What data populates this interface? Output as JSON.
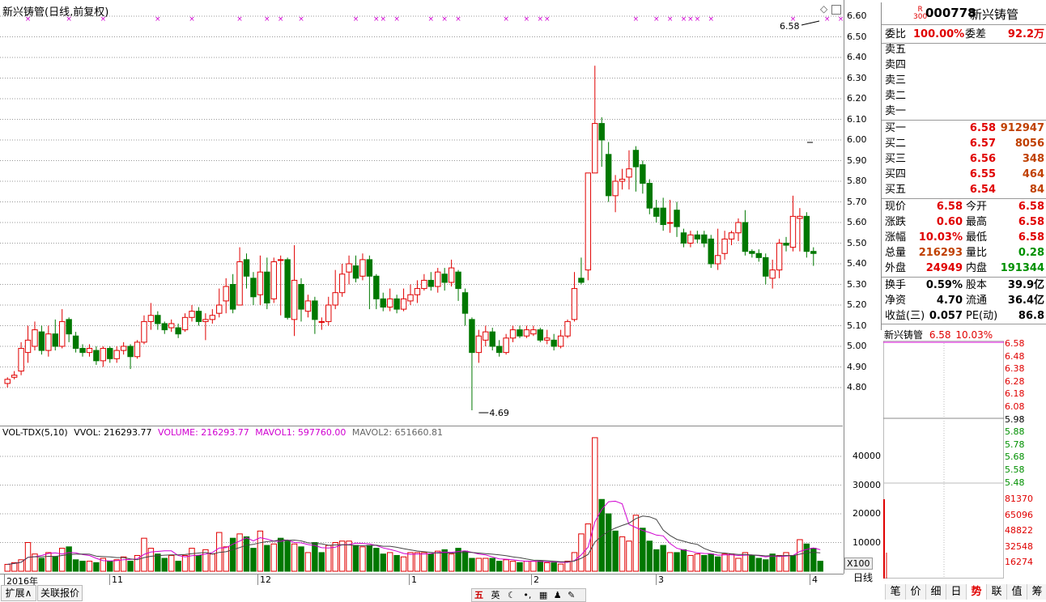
{
  "chart": {
    "title": "新兴铸管(日线,前复权)",
    "price_labels": [
      "6.60",
      "6.50",
      "6.40",
      "6.30",
      "6.20",
      "6.10",
      "6.00",
      "5.90",
      "5.80",
      "5.70",
      "5.60",
      "5.50",
      "5.40",
      "5.30",
      "5.20",
      "5.10",
      "5.00",
      "4.90",
      "4.80"
    ],
    "high_label": "6.58",
    "low_label": "4.69",
    "date_labels": [
      "2016年",
      "11",
      "12",
      "1",
      "2",
      "3",
      "4"
    ],
    "volume_header": {
      "name": "VOL-TDX(5,10)",
      "vvol": "VVOL: 216293.77",
      "volume": "VOLUME: 216293.77",
      "mavol1": "MAVOL1: 597760.00",
      "mavol2": "MAVOL2: 651660.81"
    },
    "volume_labels": [
      "40000",
      "30000",
      "20000",
      "10000"
    ],
    "volume_unit": "X100",
    "period_button": "日线",
    "expand_button": "扩展∧",
    "related_button": "关联报价"
  },
  "quote": {
    "code": "000778",
    "name": "新兴铸管",
    "badge_r": "R",
    "badge_num": "300",
    "wei_bi_label": "委比",
    "wei_bi": "100.00%",
    "wei_cha_label": "委差",
    "wei_cha": "92.2万",
    "sell": [
      {
        "label": "卖五",
        "price": "",
        "vol": ""
      },
      {
        "label": "卖四",
        "price": "",
        "vol": ""
      },
      {
        "label": "卖三",
        "price": "",
        "vol": ""
      },
      {
        "label": "卖二",
        "price": "",
        "vol": ""
      },
      {
        "label": "卖一",
        "price": "",
        "vol": ""
      }
    ],
    "buy": [
      {
        "label": "买一",
        "price": "6.58",
        "vol": "912947"
      },
      {
        "label": "买二",
        "price": "6.57",
        "vol": "8056"
      },
      {
        "label": "买三",
        "price": "6.56",
        "vol": "348"
      },
      {
        "label": "买四",
        "price": "6.55",
        "vol": "464"
      },
      {
        "label": "买五",
        "price": "6.54",
        "vol": "84"
      }
    ],
    "stats": [
      {
        "l1": "现价",
        "v1": "6.58",
        "c1": "red",
        "l2": "今开",
        "v2": "6.58",
        "c2": "red"
      },
      {
        "l1": "涨跌",
        "v1": "0.60",
        "c1": "red",
        "l2": "最高",
        "v2": "6.58",
        "c2": "red"
      },
      {
        "l1": "涨幅",
        "v1": "10.03%",
        "c1": "red",
        "l2": "最低",
        "v2": "6.58",
        "c2": "red"
      },
      {
        "l1": "总量",
        "v1": "216293",
        "c1": "orange",
        "l2": "量比",
        "v2": "0.28",
        "c2": "green"
      },
      {
        "l1": "外盘",
        "v1": "24949",
        "c1": "red",
        "l2": "内盘",
        "v2": "191344",
        "c2": "green"
      }
    ],
    "stats2": [
      {
        "l1": "换手",
        "v1": "0.59%",
        "l2": "股本",
        "v2": "39.9亿"
      },
      {
        "l1": "净资",
        "v1": "4.70",
        "l2": "流通",
        "v2": "36.4亿"
      },
      {
        "l1": "收益(三)",
        "v1": "0.057",
        "l2": "PE(动)",
        "v2": "86.8"
      }
    ]
  },
  "intraday": {
    "name": "新兴铸管",
    "price": "6.58",
    "change": "10.03%",
    "price_labels": [
      "6.58",
      "6.48",
      "6.38",
      "6.28",
      "6.18",
      "6.08",
      "5.98",
      "5.88",
      "5.78",
      "5.68",
      "5.58",
      "5.48"
    ],
    "vol_labels": [
      "81370",
      "65096",
      "48822",
      "32548",
      "16274"
    ]
  },
  "tabs": [
    "笔",
    "价",
    "细",
    "日",
    "势",
    "联",
    "值",
    "筹"
  ],
  "active_tab": "势",
  "status_icons": [
    "五",
    "英"
  ],
  "candles": [
    [
      4.82,
      4.84,
      4.8,
      4.85
    ],
    [
      4.85,
      4.86,
      4.84,
      4.88
    ],
    [
      4.88,
      4.99,
      4.86,
      5.02
    ],
    [
      4.97,
      5.03,
      4.92,
      5.1
    ],
    [
      5.0,
      5.08,
      4.98,
      5.12
    ],
    [
      5.07,
      4.98,
      4.96,
      5.1
    ],
    [
      4.98,
      5.06,
      4.95,
      5.1
    ],
    [
      5.06,
      5.0,
      4.98,
      5.13
    ],
    [
      5.0,
      5.12,
      4.99,
      5.18
    ],
    [
      5.13,
      5.06,
      5.02,
      5.14
    ],
    [
      5.05,
      4.99,
      4.97,
      5.07
    ],
    [
      4.99,
      4.97,
      4.95,
      5.01
    ],
    [
      4.97,
      4.99,
      4.95,
      5.01
    ],
    [
      4.98,
      4.93,
      4.91,
      5.0
    ],
    [
      4.93,
      4.99,
      4.9,
      5.0
    ],
    [
      4.99,
      4.94,
      4.92,
      5.0
    ],
    [
      4.94,
      4.98,
      4.92,
      5.0
    ],
    [
      4.98,
      5.0,
      4.96,
      5.02
    ],
    [
      5.0,
      4.95,
      4.89,
      5.01
    ],
    [
      4.95,
      5.02,
      4.94,
      5.03
    ],
    [
      5.02,
      5.12,
      5.01,
      5.15
    ],
    [
      5.12,
      5.15,
      5.08,
      5.21
    ],
    [
      5.15,
      5.11,
      5.08,
      5.17
    ],
    [
      5.11,
      5.08,
      5.06,
      5.12
    ],
    [
      5.09,
      5.11,
      5.07,
      5.13
    ],
    [
      5.09,
      5.06,
      5.04,
      5.11
    ],
    [
      5.08,
      5.14,
      5.07,
      5.16
    ],
    [
      5.14,
      5.17,
      5.12,
      5.2
    ],
    [
      5.17,
      5.12,
      5.1,
      5.19
    ],
    [
      5.12,
      5.13,
      5.03,
      5.16
    ],
    [
      5.13,
      5.15,
      5.11,
      5.18
    ],
    [
      5.16,
      5.2,
      5.14,
      5.28
    ],
    [
      5.22,
      5.29,
      5.16,
      5.33
    ],
    [
      5.3,
      5.18,
      5.16,
      5.35
    ],
    [
      5.2,
      5.41,
      5.2,
      5.48
    ],
    [
      5.42,
      5.34,
      5.28,
      5.45
    ],
    [
      5.33,
      5.24,
      5.2,
      5.36
    ],
    [
      5.25,
      5.36,
      5.2,
      5.44
    ],
    [
      5.36,
      5.21,
      5.18,
      5.43
    ],
    [
      5.23,
      5.41,
      5.21,
      5.43
    ],
    [
      5.42,
      5.42,
      5.15,
      5.44
    ],
    [
      5.42,
      5.14,
      5.13,
      5.43
    ],
    [
      5.13,
      5.32,
      5.05,
      5.49
    ],
    [
      5.3,
      5.18,
      5.12,
      5.33
    ],
    [
      5.17,
      5.22,
      5.14,
      5.25
    ],
    [
      5.22,
      5.13,
      5.06,
      5.24
    ],
    [
      5.12,
      5.12,
      5.08,
      5.14
    ],
    [
      5.12,
      5.2,
      5.1,
      5.24
    ],
    [
      5.2,
      5.26,
      5.18,
      5.37
    ],
    [
      5.26,
      5.35,
      5.24,
      5.4
    ],
    [
      5.36,
      5.4,
      5.3,
      5.44
    ],
    [
      5.39,
      5.33,
      5.31,
      5.44
    ],
    [
      5.34,
      5.42,
      5.32,
      5.45
    ],
    [
      5.42,
      5.34,
      5.18,
      5.44
    ],
    [
      5.34,
      5.23,
      5.18,
      5.35
    ],
    [
      5.23,
      5.19,
      5.17,
      5.26
    ],
    [
      5.19,
      5.23,
      5.17,
      5.28
    ],
    [
      5.23,
      5.18,
      5.16,
      5.25
    ],
    [
      5.18,
      5.23,
      5.17,
      5.28
    ],
    [
      5.22,
      5.25,
      5.2,
      5.3
    ],
    [
      5.25,
      5.28,
      5.21,
      5.32
    ],
    [
      5.28,
      5.32,
      5.27,
      5.35
    ],
    [
      5.32,
      5.29,
      5.27,
      5.36
    ],
    [
      5.29,
      5.36,
      5.26,
      5.38
    ],
    [
      5.35,
      5.31,
      5.27,
      5.38
    ],
    [
      5.31,
      5.38,
      5.29,
      5.42
    ],
    [
      5.36,
      5.28,
      5.22,
      5.37
    ],
    [
      5.26,
      5.16,
      5.1,
      5.28
    ],
    [
      5.13,
      4.97,
      4.69,
      5.14
    ],
    [
      4.97,
      5.05,
      4.92,
      5.08
    ],
    [
      5.03,
      5.07,
      5.0,
      5.1
    ],
    [
      5.07,
      5.0,
      4.98,
      5.09
    ],
    [
      5.0,
      4.97,
      4.95,
      5.03
    ],
    [
      4.97,
      5.04,
      4.96,
      5.06
    ],
    [
      5.04,
      5.08,
      5.02,
      5.1
    ],
    [
      5.08,
      5.05,
      5.04,
      5.1
    ],
    [
      5.05,
      5.08,
      5.04,
      5.1
    ],
    [
      5.06,
      5.08,
      5.05,
      5.1
    ],
    [
      5.08,
      5.03,
      5.02,
      5.09
    ],
    [
      5.03,
      5.04,
      5.01,
      5.08
    ],
    [
      5.03,
      5.0,
      4.98,
      5.06
    ],
    [
      5.0,
      5.05,
      4.99,
      5.08
    ],
    [
      5.05,
      5.12,
      5.04,
      5.13
    ],
    [
      5.13,
      5.28,
      5.12,
      5.36
    ],
    [
      5.33,
      5.31,
      5.3,
      5.43
    ],
    [
      5.37,
      5.84,
      5.32,
      5.84
    ],
    [
      5.84,
      6.08,
      5.92,
      6.36
    ],
    [
      6.08,
      6.0,
      5.87,
      6.11
    ],
    [
      5.93,
      5.73,
      5.7,
      5.99
    ],
    [
      5.73,
      5.8,
      5.65,
      5.83
    ],
    [
      5.8,
      5.81,
      5.76,
      5.86
    ],
    [
      5.82,
      5.86,
      5.76,
      5.95
    ],
    [
      5.95,
      5.87,
      5.75,
      5.97
    ],
    [
      5.88,
      5.79,
      5.74,
      5.9
    ],
    [
      5.79,
      5.67,
      5.64,
      5.81
    ],
    [
      5.67,
      5.63,
      5.6,
      5.71
    ],
    [
      5.67,
      5.59,
      5.56,
      5.72
    ],
    [
      5.6,
      5.6,
      5.55,
      5.71
    ],
    [
      5.66,
      5.58,
      5.53,
      5.7
    ],
    [
      5.55,
      5.5,
      5.48,
      5.57
    ],
    [
      5.5,
      5.54,
      5.48,
      5.56
    ],
    [
      5.54,
      5.52,
      5.5,
      5.56
    ],
    [
      5.54,
      5.5,
      5.48,
      5.56
    ],
    [
      5.52,
      5.4,
      5.38,
      5.54
    ],
    [
      5.4,
      5.44,
      5.37,
      5.57
    ],
    [
      5.45,
      5.52,
      5.42,
      5.56
    ],
    [
      5.52,
      5.55,
      5.49,
      5.56
    ],
    [
      5.55,
      5.6,
      5.51,
      5.62
    ],
    [
      5.6,
      5.46,
      5.44,
      5.66
    ],
    [
      5.46,
      5.45,
      5.43,
      5.47
    ],
    [
      5.45,
      5.43,
      5.41,
      5.47
    ],
    [
      5.43,
      5.34,
      5.3,
      5.45
    ],
    [
      5.33,
      5.37,
      5.28,
      5.42
    ],
    [
      5.37,
      5.5,
      5.33,
      5.52
    ],
    [
      5.5,
      5.49,
      5.46,
      5.53
    ],
    [
      5.48,
      5.63,
      5.46,
      5.73
    ],
    [
      5.62,
      5.63,
      5.46,
      5.67
    ],
    [
      5.63,
      5.46,
      5.43,
      5.65
    ],
    [
      5.46,
      5.45,
      5.39,
      5.48
    ]
  ],
  "volumes": [
    [
      2400,
      1
    ],
    [
      3000,
      1
    ],
    [
      4000,
      1
    ],
    [
      10000,
      1
    ],
    [
      6000,
      1
    ],
    [
      4500,
      0
    ],
    [
      6500,
      1
    ],
    [
      5000,
      0
    ],
    [
      8000,
      1
    ],
    [
      8500,
      0
    ],
    [
      4000,
      0
    ],
    [
      3500,
      0
    ],
    [
      3500,
      1
    ],
    [
      3000,
      0
    ],
    [
      4500,
      1
    ],
    [
      3500,
      0
    ],
    [
      4000,
      1
    ],
    [
      5000,
      1
    ],
    [
      3500,
      0
    ],
    [
      5500,
      1
    ],
    [
      11500,
      1
    ],
    [
      8000,
      1
    ],
    [
      6000,
      0
    ],
    [
      4500,
      0
    ],
    [
      5500,
      1
    ],
    [
      3500,
      0
    ],
    [
      5500,
      1
    ],
    [
      8000,
      1
    ],
    [
      5500,
      0
    ],
    [
      7500,
      1
    ],
    [
      6000,
      1
    ],
    [
      13500,
      1
    ],
    [
      8500,
      1
    ],
    [
      11500,
      0
    ],
    [
      13000,
      1
    ],
    [
      12000,
      0
    ],
    [
      8000,
      0
    ],
    [
      14000,
      1
    ],
    [
      9000,
      0
    ],
    [
      9500,
      1
    ],
    [
      11500,
      0
    ],
    [
      10500,
      0
    ],
    [
      9500,
      1
    ],
    [
      8500,
      0
    ],
    [
      6500,
      1
    ],
    [
      10000,
      0
    ],
    [
      6500,
      0
    ],
    [
      9000,
      1
    ],
    [
      10000,
      1
    ],
    [
      10500,
      1
    ],
    [
      10500,
      1
    ],
    [
      9000,
      0
    ],
    [
      8500,
      1
    ],
    [
      9000,
      0
    ],
    [
      8000,
      0
    ],
    [
      6000,
      0
    ],
    [
      6500,
      1
    ],
    [
      5500,
      0
    ],
    [
      5000,
      1
    ],
    [
      6500,
      1
    ],
    [
      6500,
      1
    ],
    [
      6500,
      1
    ],
    [
      6000,
      0
    ],
    [
      7000,
      1
    ],
    [
      7500,
      0
    ],
    [
      6000,
      1
    ],
    [
      8000,
      0
    ],
    [
      7000,
      0
    ],
    [
      4500,
      0
    ],
    [
      4500,
      1
    ],
    [
      4500,
      1
    ],
    [
      4500,
      0
    ],
    [
      3500,
      0
    ],
    [
      4000,
      1
    ],
    [
      3500,
      1
    ],
    [
      3000,
      0
    ],
    [
      3500,
      1
    ],
    [
      3500,
      1
    ],
    [
      3500,
      0
    ],
    [
      3000,
      1
    ],
    [
      3000,
      0
    ],
    [
      2500,
      1
    ],
    [
      3500,
      1
    ],
    [
      6500,
      1
    ],
    [
      13000,
      1
    ],
    [
      16500,
      1
    ],
    [
      46500,
      1
    ],
    [
      25000,
      0
    ],
    [
      20000,
      0
    ],
    [
      14000,
      0
    ],
    [
      12000,
      1
    ],
    [
      10500,
      1
    ],
    [
      19500,
      1
    ],
    [
      15000,
      0
    ],
    [
      10500,
      0
    ],
    [
      7500,
      0
    ],
    [
      9000,
      0
    ],
    [
      6500,
      1
    ],
    [
      6500,
      0
    ],
    [
      7500,
      0
    ],
    [
      5500,
      1
    ],
    [
      6000,
      1
    ],
    [
      5500,
      0
    ],
    [
      6000,
      0
    ],
    [
      5000,
      0
    ],
    [
      6000,
      1
    ],
    [
      6000,
      1
    ],
    [
      4500,
      1
    ],
    [
      6500,
      1
    ],
    [
      5500,
      0
    ],
    [
      4500,
      0
    ],
    [
      4000,
      0
    ],
    [
      6000,
      0
    ],
    [
      5500,
      1
    ],
    [
      6500,
      1
    ],
    [
      5500,
      0
    ],
    [
      11000,
      1
    ],
    [
      9500,
      0
    ],
    [
      8000,
      0
    ],
    [
      3500,
      0
    ]
  ],
  "signal_marks": [
    3,
    9,
    14,
    22,
    27,
    34,
    38,
    40,
    43,
    51,
    54,
    55,
    57,
    62,
    64,
    66,
    73,
    76,
    78,
    79,
    92,
    95,
    97,
    99,
    100,
    101,
    103,
    115,
    120,
    122,
    130,
    141,
    144,
    146
  ],
  "chart_colors": {
    "up": "#e00000",
    "down": "#007800",
    "ma1": "#d000d0",
    "ma2": "#444444",
    "grid": "#999999"
  }
}
